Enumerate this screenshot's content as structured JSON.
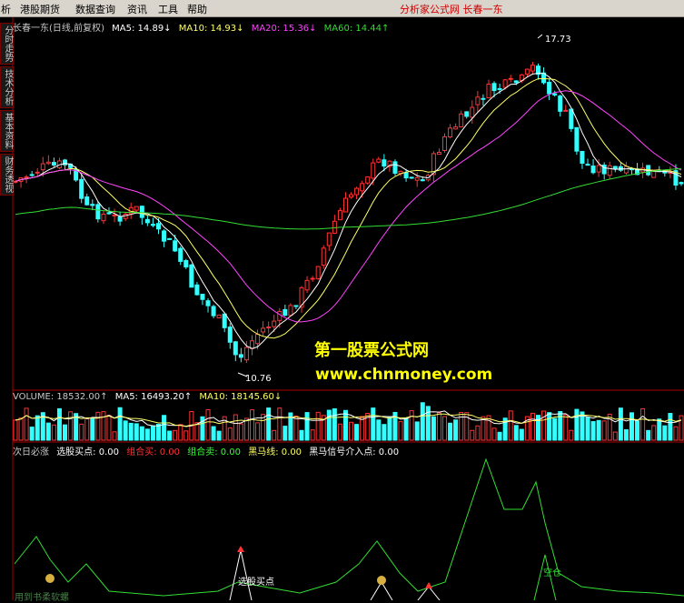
{
  "menu": {
    "items": [
      "析",
      "港股期货",
      "数据查询",
      "资讯",
      "工具",
      "帮助"
    ],
    "brand": "分析家公式网  长春一东"
  },
  "side_tabs": [
    "分时走势",
    "技术分析",
    "基本资料",
    "财务透视"
  ],
  "price_panel": {
    "legend": [
      {
        "text": "长春一东(日线,前复权)",
        "color": "#c8c8c8"
      },
      {
        "text": "MA5: 14.89↓",
        "color": "#ffffff"
      },
      {
        "text": "MA10: 14.93↓",
        "color": "#ffff66"
      },
      {
        "text": "MA20: 15.36↓",
        "color": "#ff44ff"
      },
      {
        "text": "MA60: 14.44↑",
        "color": "#33dd33"
      }
    ],
    "high_label": "17.73",
    "low_label": "10.76"
  },
  "volume_panel": {
    "legend": [
      {
        "text": "VOLUME: 18532.00↑",
        "color": "#c8c8c8"
      },
      {
        "text": "MA5: 16493.20↑",
        "color": "#ffffff"
      },
      {
        "text": "MA10: 18145.60↓",
        "color": "#ffff66"
      }
    ]
  },
  "indicator_panel": {
    "legend": [
      {
        "text": "次日必涨",
        "color": "#c8c8c8"
      },
      {
        "text": "选股买点: 0.00",
        "color": "#ffffff"
      },
      {
        "text": "组合买: 0.00",
        "color": "#ff3333"
      },
      {
        "text": "组合卖: 0.00",
        "color": "#33ff33"
      },
      {
        "text": "黑马线: 0.00",
        "color": "#ffff66"
      },
      {
        "text": "黑马信号介入点: 0.00",
        "color": "#ffffff"
      }
    ],
    "buy_label": "选股买点",
    "sell_label": "空仓",
    "footer": "用到书柔软螺"
  },
  "watermark": {
    "line1": "第一股票公式网",
    "line2": "www.chnmoney.com"
  },
  "colors": {
    "up": "#ff3333",
    "down": "#33ffff",
    "ma5": "#ffffff",
    "ma10": "#ffff66",
    "ma20": "#ff44ff",
    "ma60": "#33dd33",
    "indicator_line": "#33dd33",
    "border": "#aa0000"
  }
}
